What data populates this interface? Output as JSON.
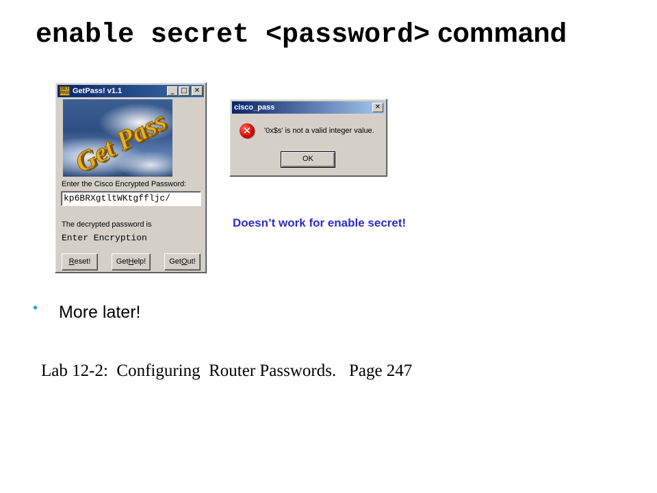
{
  "slide": {
    "title_command_mono": "enable secret <password>",
    "title_command_sans": "command",
    "note": "Doesn’t work for enable secret!",
    "bullet": "More later!",
    "lab_reference": "Lab 12-2:  Configuring  Router Passwords.   Page 247",
    "colors": {
      "note": "#2c2cc8",
      "bullet": "#2aa6b8"
    }
  },
  "getpass_window": {
    "title": "GetPass!  v1.1",
    "app_icon_text": "GET PASS",
    "title_buttons": {
      "minimize": "_",
      "maximize": "□",
      "close": "✕"
    },
    "art_text": "Get Pass",
    "encrypted_label": "Enter the Cisco Encrypted Password:",
    "encrypted_value": "kp6BRXgtltWKtgffljc/",
    "decrypted_label": "The decrypted password is",
    "decrypted_value": "Enter Encryption",
    "buttons": [
      {
        "label_pre": "",
        "label_ul": "R",
        "label_post": "eset!"
      },
      {
        "label_pre": "Get",
        "label_ul": "H",
        "label_post": "elp!"
      },
      {
        "label_pre": "Get",
        "label_ul": "O",
        "label_post": "ut!"
      }
    ]
  },
  "error_dialog": {
    "title": "cisco_pass",
    "close_button": "✕",
    "icon": "error-x-icon",
    "icon_glyph": "✕",
    "message": "'0x$s' is not a valid integer value.",
    "ok_label": "OK"
  }
}
